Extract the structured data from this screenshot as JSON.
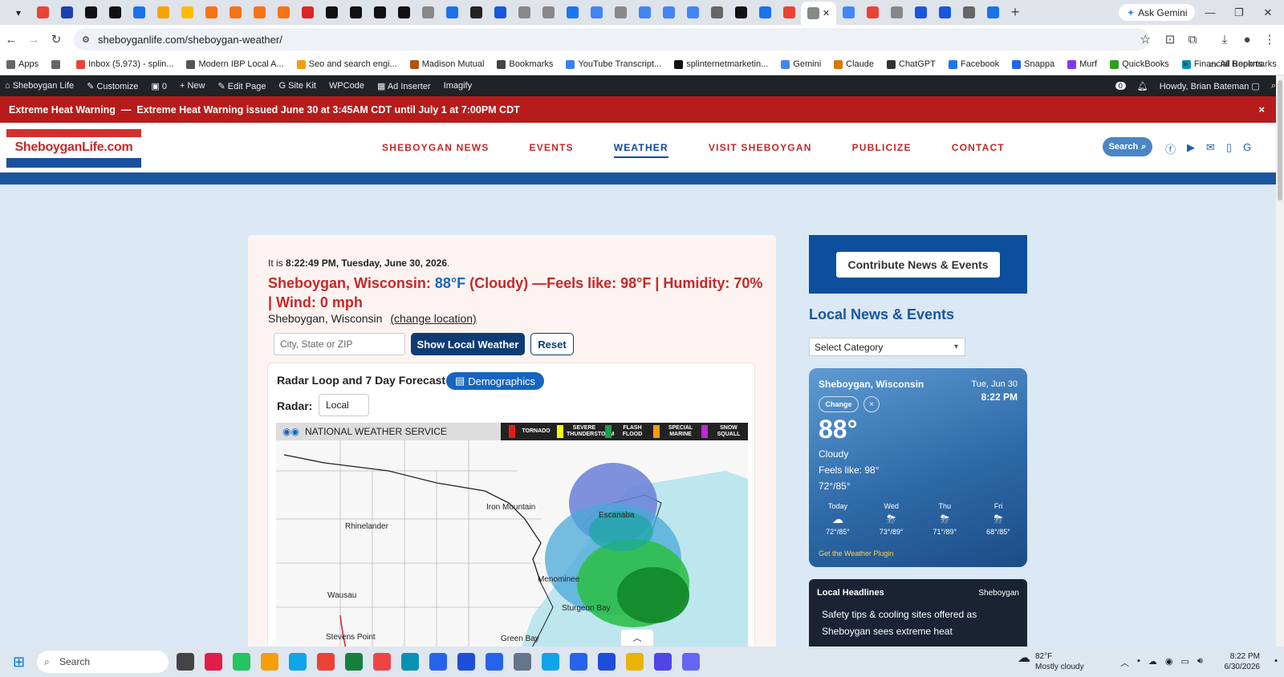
{
  "browser": {
    "tab_colors": [
      "#ea4335",
      "#1e40af",
      "#111111",
      "#111111",
      "#1a73e8",
      "#f4a300",
      "#fbbc04",
      "#f97316",
      "#f97316",
      "#f97316",
      "#f97316",
      "#dc2626",
      "#111111",
      "#111111",
      "#111111",
      "#111111",
      "#888888",
      "#1a73e8",
      "#222222",
      "#1a56db",
      "#888888",
      "#888888",
      "#1877f2",
      "#4285f4",
      "#888888",
      "#4285f4",
      "#4285f4",
      "#4285f4",
      "#666666",
      "#111111",
      "#1a73e8",
      "#ea4335"
    ],
    "tab_colors_after": [
      "#4285f4",
      "#ea4335",
      "#888888",
      "#1a56db",
      "#1a56db",
      "#666666",
      "#1a73e8"
    ],
    "ask_gemini": "Ask Gemini",
    "url": "sheboyganlife.com/sheboygan-weather/"
  },
  "bookmarks": [
    {
      "label": "Apps",
      "color": "#666"
    },
    {
      "label": "",
      "color": "#666"
    },
    {
      "label": "Inbox (5,973) - splin...",
      "color": "#ea4335"
    },
    {
      "label": "Modern IBP Local A...",
      "color": "#555"
    },
    {
      "label": "Seo and search engi...",
      "color": "#f59e0b"
    },
    {
      "label": "Madison Mutual",
      "color": "#b45309"
    },
    {
      "label": "Bookmarks",
      "color": "#444"
    },
    {
      "label": "YouTube Transcript...",
      "color": "#3b82f6"
    },
    {
      "label": "splinternetmarketin...",
      "color": "#111"
    },
    {
      "label": "Gemini",
      "color": "#4285f4"
    },
    {
      "label": "Claude",
      "color": "#d97706"
    },
    {
      "label": "ChatGPT",
      "color": "#333"
    },
    {
      "label": "Facebook",
      "color": "#1877f2"
    },
    {
      "label": "Snappa",
      "color": "#2563eb"
    },
    {
      "label": "Murf",
      "color": "#7c3aed"
    },
    {
      "label": "QuickBooks",
      "color": "#2ca01c"
    },
    {
      "label": "Financial Reports",
      "color": "#0891b2"
    }
  ],
  "all_bookmarks": "All Bookmarks",
  "wpbar": {
    "site": "Sheboygan Life",
    "customize": "Customize",
    "comments": "0",
    "new": "New",
    "edit": "Edit Page",
    "sitekit": "Site Kit",
    "wpcode": "WPCode",
    "adinserter": "Ad Inserter",
    "imagify": "Imagify",
    "notif": "0",
    "howdy": "Howdy, Brian Bateman"
  },
  "alert": {
    "title": "Extreme Heat Warning",
    "sep": "—",
    "text": "Extreme Heat Warning issued June 30 at 3:45AM CDT until July 1 at 7:00PM CDT",
    "close": "×"
  },
  "header": {
    "logo": "SheboyganLife.com",
    "nav": [
      "SHEBOYGAN NEWS",
      "EVENTS",
      "WEATHER",
      "VISIT SHEBOYGAN",
      "PUBLICIZE",
      "CONTACT"
    ],
    "search": "Search"
  },
  "weather": {
    "it_is": "It is",
    "time": "8:22:49 PM, Tuesday, June 30, 2026",
    "place": "Sheboygan, Wisconsin:",
    "temp": "88°F",
    "rest": "(Cloudy) —Feels like: 98°F | Humidity: 70% | Wind: 0 mph",
    "location": "Sheboygan, Wisconsin",
    "change_location": "(change location)",
    "input_placeholder": "City, State or ZIP",
    "show": "Show Local Weather",
    "reset": "Reset",
    "radar_title": "Radar Loop and 7 Day Forecast",
    "demographics": "Demographics",
    "radar_label": "Radar:",
    "radar_value": "Local",
    "nws": "NATIONAL WEATHER SERVICE",
    "legend": [
      {
        "label": "TORNADO",
        "color": "#e11d1d"
      },
      {
        "label": "SEVERE THUNDERSTORM",
        "color": "#ffff00"
      },
      {
        "label": "FLASH FLOOD",
        "color": "#16a34a"
      },
      {
        "label": "SPECIAL MARINE",
        "color": "#f59e0b"
      },
      {
        "label": "SNOW SQUALL",
        "color": "#c026d3"
      }
    ],
    "cities": [
      "Iron Mountain",
      "Escanaba",
      "Rhinelander",
      "Menominee",
      "Sturgeon Bay",
      "Wausau",
      "Stevens Point",
      "Green Bay"
    ]
  },
  "sidebar": {
    "contribute": "Contribute News & Events",
    "heading": "Local News & Events",
    "category": "Select Category"
  },
  "widget": {
    "city": "Sheboygan, Wisconsin",
    "date": "Tue, Jun 30",
    "time": "8:22 PM",
    "change": "Change",
    "close": "×",
    "temp": "88°",
    "cond": "Cloudy",
    "feels": "Feels like: 98°",
    "range": "72°/85°",
    "days": [
      {
        "day": "Today",
        "range": "72°/85°"
      },
      {
        "day": "Wed",
        "range": "73°/89°"
      },
      {
        "day": "Thu",
        "range": "71°/89°"
      },
      {
        "day": "Fri",
        "range": "68°/85°"
      }
    ],
    "plugin": "Get the Weather Plugin"
  },
  "headlines": {
    "title": "Local Headlines",
    "source": "Sheboygan",
    "item": "Safety tips & cooling sites offered as Sheboygan sees extreme heat"
  },
  "taskbar": {
    "search": "Search",
    "app_colors": [
      "#444",
      "#e11d48",
      "#22c55e",
      "#f59e0b",
      "#0ea5e9",
      "#ea4335",
      "#15803d",
      "#ef4444",
      "#0891b2",
      "#2563eb",
      "#1d4ed8",
      "#2563eb",
      "#64748b",
      "#0ea5e9",
      "#2563eb",
      "#1d4ed8",
      "#eab308",
      "#4f46e5",
      "#6366f1"
    ],
    "weather_temp": "82°F",
    "weather_desc": "Mostly cloudy",
    "time": "8:22 PM",
    "date": "6/30/2026"
  }
}
